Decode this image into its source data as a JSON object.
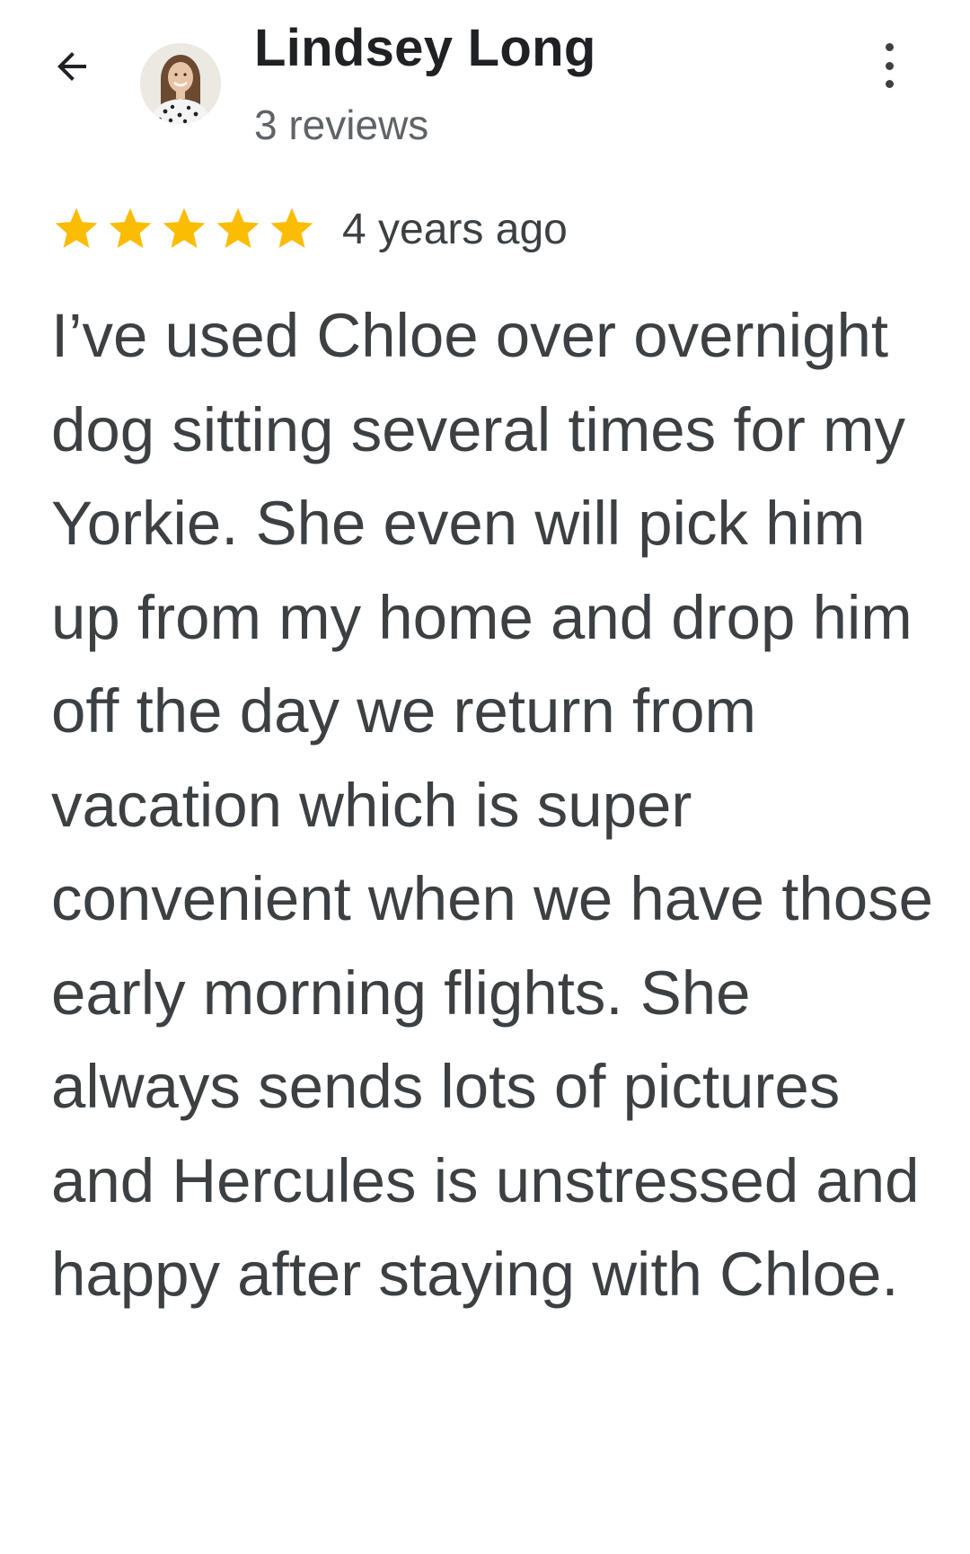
{
  "reviewer": {
    "name": "Lindsey Long",
    "review_count": "3 reviews",
    "avatar_icon": "profile-photo"
  },
  "header": {
    "back_icon": "arrow-left-icon",
    "more_icon": "more-vertical-icon"
  },
  "review": {
    "rating": 5,
    "max_rating": 5,
    "star_color": "#fbbc04",
    "time_ago": "4 years ago",
    "text": "I’ve used Chloe over overnight dog sitting several times for my Yorkie. She even will pick him up from my home and drop him off the day we return from vacation which is super convenient when we have those early morning flights. She always sends lots of pictures and Hercules is unstressed and happy after staying with Chloe."
  }
}
